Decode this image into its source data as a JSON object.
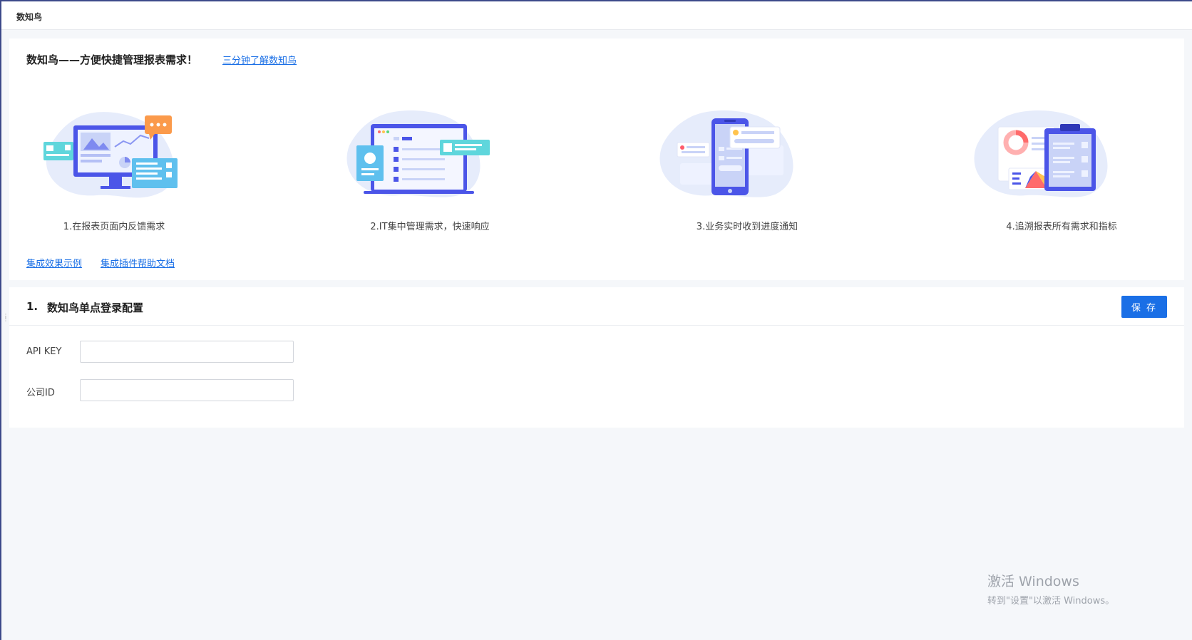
{
  "topbar": {
    "title": "数知鸟"
  },
  "intro": {
    "title": "数知鸟——方便快捷管理报表需求！",
    "learn_link": "三分钟了解数知鸟",
    "features": [
      {
        "label": "1.在报表页面内反馈需求",
        "icon": "monitor-illustration"
      },
      {
        "label": "2.IT集中管理需求，快速响应",
        "icon": "laptop-illustration"
      },
      {
        "label": "3.业务实时收到进度通知",
        "icon": "phone-illustration"
      },
      {
        "label": "4.追溯报表所有需求和指标",
        "icon": "clipboard-illustration"
      }
    ],
    "links": {
      "example": "集成效果示例",
      "help": "集成插件帮助文档"
    }
  },
  "config": {
    "section_number": "1.",
    "section_title": "数知鸟单点登录配置",
    "save_label": "保 存",
    "fields": [
      {
        "label": "API KEY",
        "value": ""
      },
      {
        "label": "公司ID",
        "value": ""
      }
    ]
  },
  "watermark": {
    "title": "激活 Windows",
    "subtitle": "转到\"设置\"以激活 Windows。"
  },
  "colors": {
    "accent": "#1a6fe6",
    "illustration_primary": "#4b55e8",
    "illustration_teal": "#5fd6dc"
  }
}
